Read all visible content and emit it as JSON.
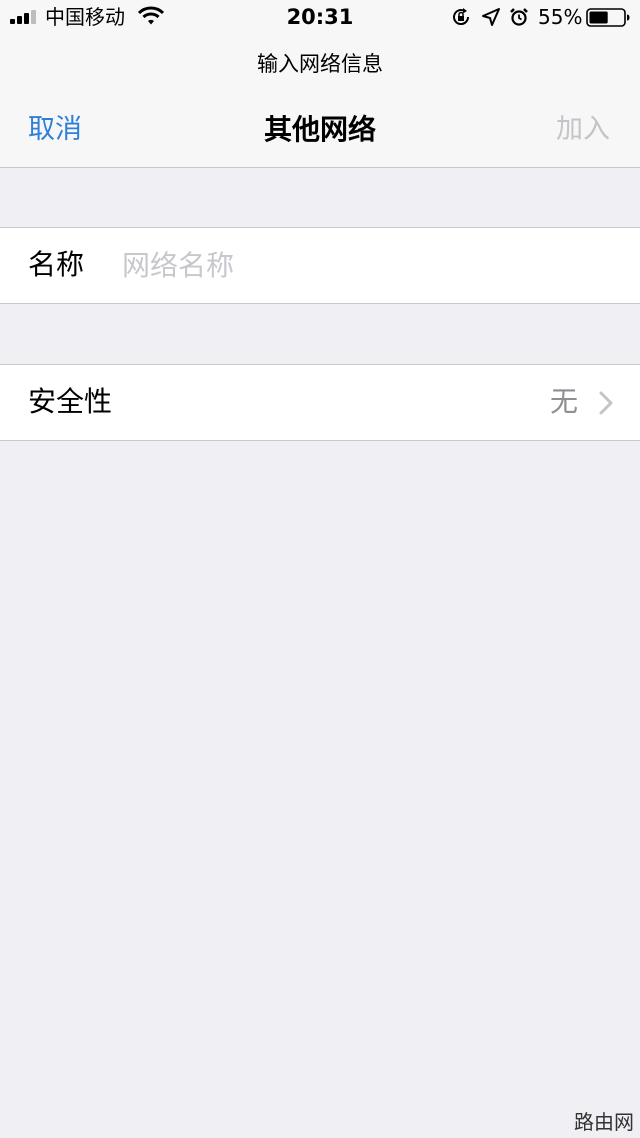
{
  "status_bar": {
    "carrier": "中国移动",
    "time": "20:31",
    "battery_percent": "55%",
    "battery_level": 0.55,
    "signal_bars": 3,
    "icons": [
      "signal-icon",
      "wifi-icon",
      "orientation-lock-icon",
      "location-icon",
      "alarm-icon",
      "battery-icon"
    ]
  },
  "prompt": "输入网络信息",
  "nav": {
    "cancel_label": "取消",
    "title": "其他网络",
    "join_label": "加入"
  },
  "form": {
    "name_label": "名称",
    "name_value": "",
    "name_placeholder": "网络名称",
    "security_label": "安全性",
    "security_value": "无"
  },
  "watermark": "路由网",
  "colors": {
    "accent": "#2f7fd9",
    "disabled": "#c4c4c8",
    "background": "#efeff4",
    "placeholder": "#c7c7cd",
    "secondary_text": "#8e8e93"
  }
}
